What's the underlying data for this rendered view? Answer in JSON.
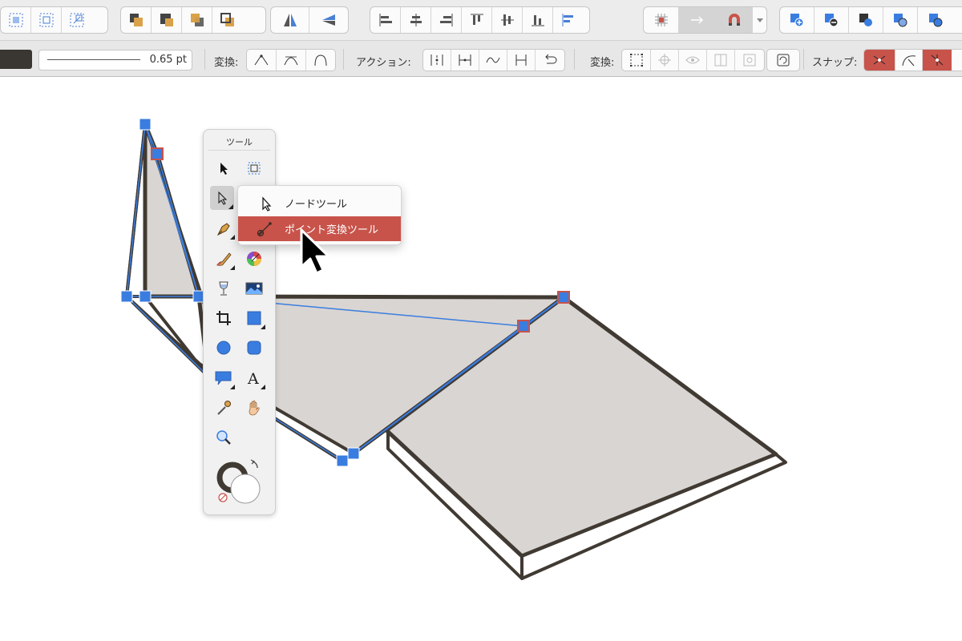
{
  "toolbar": {
    "stroke_width": "0.65 pt",
    "transform_label": "変換:",
    "action_label": "アクション:",
    "transform2_label": "変換:",
    "snap_label": "スナップ:"
  },
  "palette": {
    "title": "ツール"
  },
  "popup": {
    "items": [
      {
        "label": "ノードツール",
        "icon": "node-tool-icon"
      },
      {
        "label": "ポイント変換ツール",
        "icon": "point-transform-icon"
      }
    ]
  },
  "colors": {
    "highlight": "#c8534a",
    "node": "#3a7de0",
    "shape_fill": "#d9d5d2",
    "shape_stroke": "#403a33"
  }
}
